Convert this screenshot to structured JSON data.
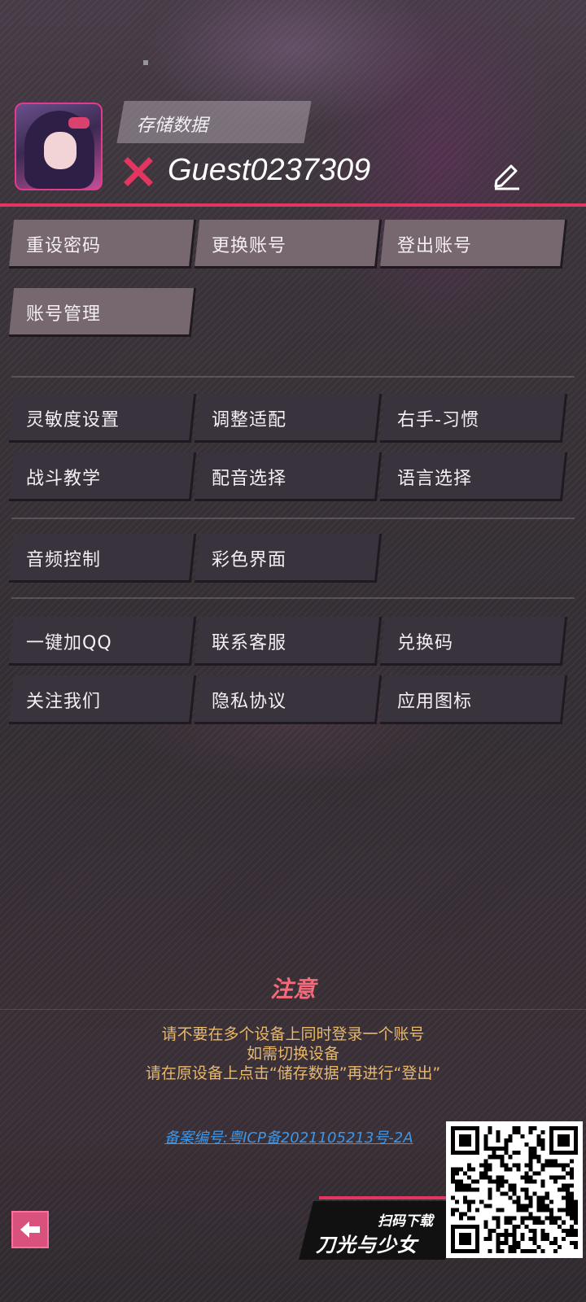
{
  "header": {
    "save_data_label": "存储数据",
    "username": "Guest0237309"
  },
  "account_buttons": [
    {
      "label": "重设密码"
    },
    {
      "label": "更换账号"
    },
    {
      "label": "登出账号"
    },
    {
      "label": "账号管理"
    }
  ],
  "settings_buttons": [
    {
      "label": "灵敏度设置"
    },
    {
      "label": "调整适配"
    },
    {
      "label": "右手-习惯"
    },
    {
      "label": "战斗教学"
    },
    {
      "label": "配音选择"
    },
    {
      "label": "语言选择"
    }
  ],
  "display_buttons": [
    {
      "label": "音频控制"
    },
    {
      "label": "彩色界面"
    }
  ],
  "social_buttons": [
    {
      "label": "一键加QQ"
    },
    {
      "label": "联系客服"
    },
    {
      "label": "兑换码"
    },
    {
      "label": "关注我们"
    },
    {
      "label": "隐私协议"
    },
    {
      "label": "应用图标"
    }
  ],
  "notice": {
    "title": "注意",
    "lines": [
      "请不要在多个设备上同时登录一个账号",
      "如需切换设备",
      "请在原设备上点击“储存数据”再进行“登出”"
    ]
  },
  "icp_text": "备案编号:粤ICP备2021105213号-2A",
  "qr_banner": {
    "top_text": "扫码下载",
    "game_title": "刀光与少女"
  },
  "colors": {
    "accent": "#e2355f",
    "notice_title": "#f56a7a",
    "notice_text": "#e9b86a",
    "link": "#3c96ea"
  }
}
